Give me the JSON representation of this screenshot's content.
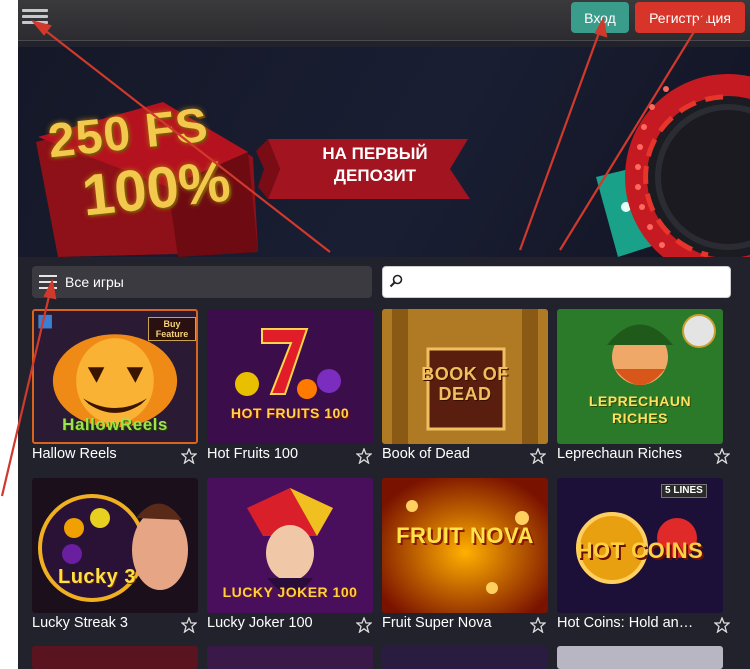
{
  "header": {
    "login_label": "Вход",
    "register_label": "Регистрация"
  },
  "banner": {
    "line1": "250 FS",
    "line2": "100%",
    "ribbon_line1": "НА ПЕРВЫЙ",
    "ribbon_line2": "ДЕПОЗИТ"
  },
  "filter": {
    "categories_label": "Все игры",
    "search_value": "",
    "search_placeholder": ""
  },
  "games": [
    {
      "name": "Hallow Reels",
      "art_text": "HallowReels",
      "badge": "Buy Feature"
    },
    {
      "name": "Hot Fruits 100",
      "art_text": "HOT FRUITS 100",
      "badge": ""
    },
    {
      "name": "Book of Dead",
      "art_text": "BOOK OF DEAD",
      "badge": ""
    },
    {
      "name": "Leprechaun Riches",
      "art_text": "LEPRECHAUN RICHES",
      "badge": ""
    },
    {
      "name": "Lucky Streak 3",
      "art_text": "Lucky 3",
      "badge": ""
    },
    {
      "name": "Lucky Joker 100",
      "art_text": "LUCKY JOKER 100",
      "badge": ""
    },
    {
      "name": "Fruit Super Nova",
      "art_text": "FRUIT NOVA",
      "badge": ""
    },
    {
      "name": "Hot Coins: Hold and Win",
      "art_text": "HOT COINS",
      "badge": "5 LINES"
    }
  ],
  "colors": {
    "accent_login": "#3a9c8a",
    "accent_register": "#d8342a",
    "annotation_arrow": "#d0392b"
  }
}
